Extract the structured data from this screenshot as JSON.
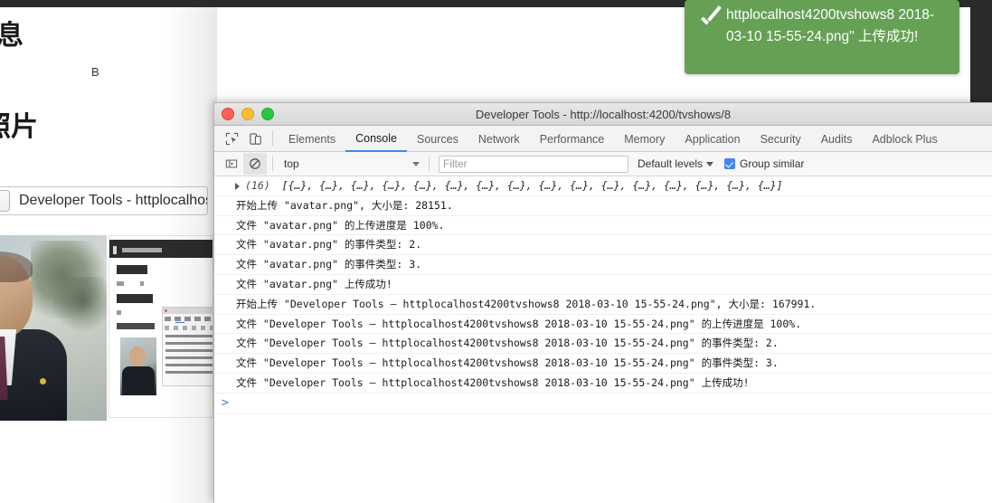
{
  "background_page": {
    "headings": {
      "basic_info": "信息",
      "photos": "剧照片"
    },
    "letter_b": "B",
    "file_input": {
      "choose_label": "",
      "file_name": "Developer Tools - httplocalhos"
    }
  },
  "toast": {
    "icon": "check-icon",
    "message": "httplocalhost4200tvshows8 2018-03-10 15-55-24.png\" 上传成功!",
    "background_color": "#65a055"
  },
  "devtools": {
    "window_title": "Developer Tools - http://localhost:4200/tvshows/8",
    "traffic_lights": {
      "close": "#fe5f57",
      "minimize": "#febc2e",
      "maximize": "#28c840"
    },
    "tabs": [
      {
        "label": "Elements",
        "active": false
      },
      {
        "label": "Console",
        "active": true
      },
      {
        "label": "Sources",
        "active": false
      },
      {
        "label": "Network",
        "active": false
      },
      {
        "label": "Performance",
        "active": false
      },
      {
        "label": "Memory",
        "active": false
      },
      {
        "label": "Application",
        "active": false
      },
      {
        "label": "Security",
        "active": false
      },
      {
        "label": "Audits",
        "active": false
      },
      {
        "label": "Adblock Plus",
        "active": false
      }
    ],
    "toolbar": {
      "inspect_icon": "inspect-element-icon",
      "device_icon": "device-toolbar-icon",
      "sidebar_icon": "console-sidebar-icon",
      "clear_icon": "clear-console-icon",
      "context": "top",
      "filter_placeholder": "Filter",
      "levels": "Default levels",
      "group_similar": "Group similar",
      "group_similar_checked": true,
      "accent_color": "#4285f4"
    },
    "console": {
      "array_entry": {
        "count": "(16)",
        "preview": "[{…}, {…}, {…}, {…}, {…}, {…}, {…}, {…}, {…}, {…}, {…}, {…}, {…}, {…}, {…}, {…}]"
      },
      "lines": [
        "开始上传 \"avatar.png\", 大小是: 28151.",
        "文件 \"avatar.png\" 的上传进度是 100%.",
        "文件 \"avatar.png\" 的事件类型: 2.",
        "文件 \"avatar.png\" 的事件类型: 3.",
        "文件 \"avatar.png\" 上传成功!",
        "开始上传 \"Developer Tools – httplocalhost4200tvshows8 2018-03-10 15-55-24.png\", 大小是: 167991.",
        "文件 \"Developer Tools – httplocalhost4200tvshows8 2018-03-10 15-55-24.png\" 的上传进度是 100%.",
        "文件 \"Developer Tools – httplocalhost4200tvshows8 2018-03-10 15-55-24.png\" 的事件类型: 2.",
        "文件 \"Developer Tools – httplocalhost4200tvshows8 2018-03-10 15-55-24.png\" 的事件类型: 3.",
        "文件 \"Developer Tools – httplocalhost4200tvshows8 2018-03-10 15-55-24.png\" 上传成功!"
      ],
      "prompt": ">"
    }
  }
}
